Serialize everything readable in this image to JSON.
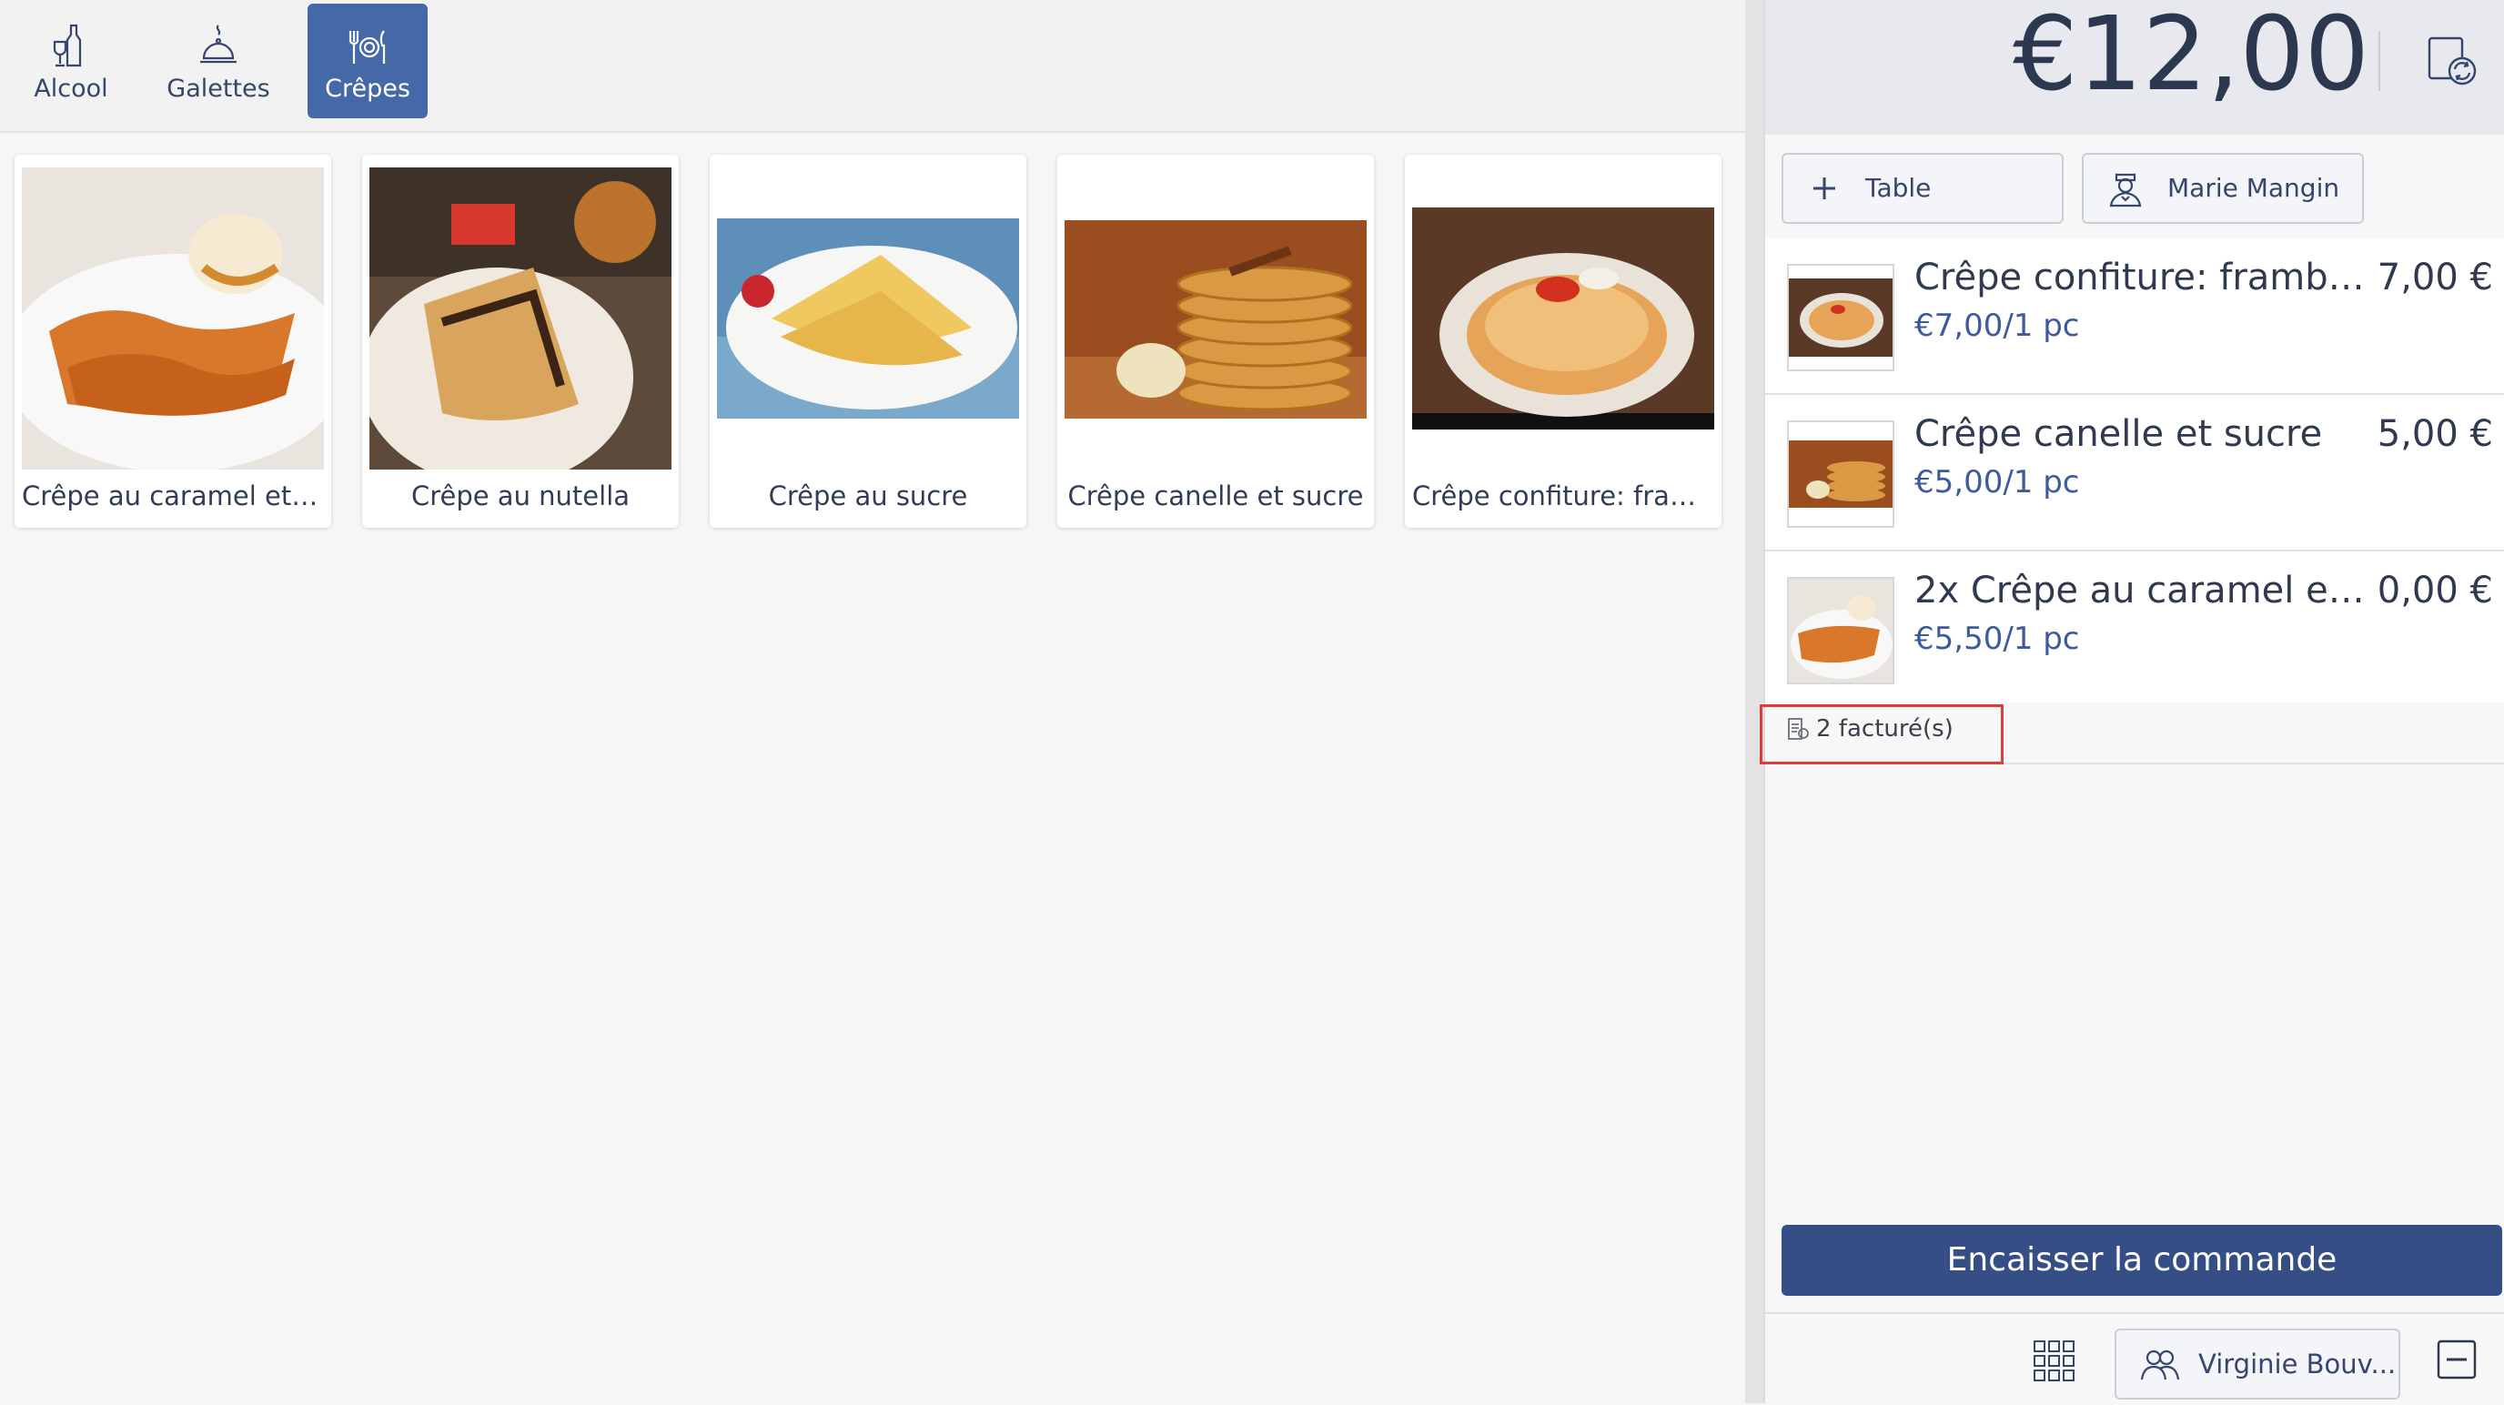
{
  "categories": [
    {
      "label": "Alcool",
      "icon": "bottle-glass-icon"
    },
    {
      "label": "Galettes",
      "icon": "cloche-icon"
    },
    {
      "label": "Crêpes",
      "icon": "fork-plate-knife-icon",
      "active": true
    }
  ],
  "products": [
    {
      "label": "Crêpe au caramel et b..."
    },
    {
      "label": "Crêpe au nutella"
    },
    {
      "label": "Crêpe au sucre"
    },
    {
      "label": "Crêpe canelle et sucre"
    },
    {
      "label": "Crêpe confiture: fram..."
    }
  ],
  "order": {
    "total": "€12,00",
    "table_button": "Table",
    "waiter_button": "Marie Mangin",
    "items": [
      {
        "name": "Crêpe confiture: framboise...",
        "price": "7,00 €",
        "unit": "€7,00/1 pc"
      },
      {
        "name": "Crêpe canelle et sucre",
        "price": "5,00 €",
        "unit": "€5,00/1 pc"
      },
      {
        "name": "2x Crêpe au caramel et beu...",
        "price": "0,00 €",
        "unit": "€5,50/1 pc"
      }
    ],
    "billed_note": "2 facturé(s)",
    "pay_button": "Encaisser la commande",
    "user_button": "Virginie Bouv..."
  },
  "colors": {
    "accent": "#4468a8",
    "pay_button": "#354e85",
    "highlight": "#e03a3a",
    "unit_text": "#3e5b9b"
  }
}
